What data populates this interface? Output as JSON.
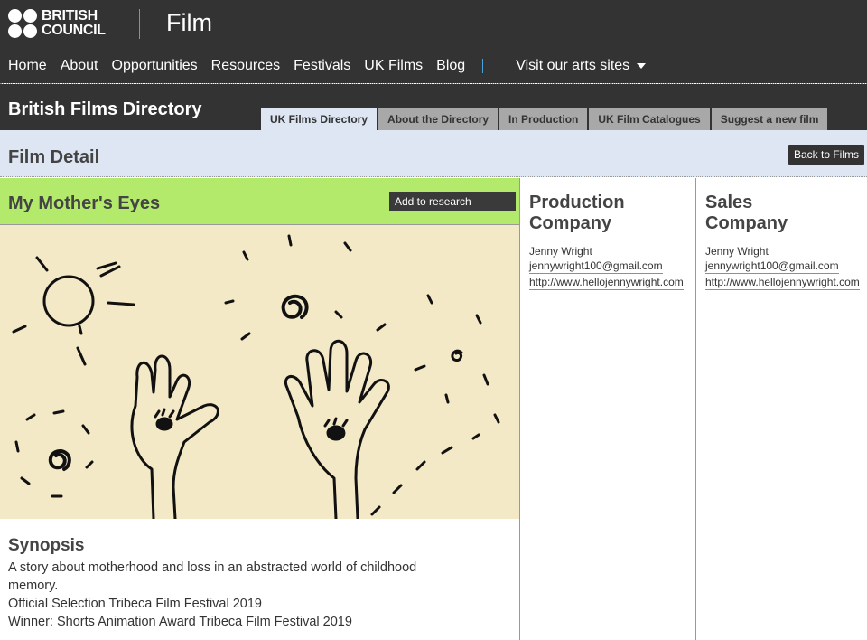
{
  "header": {
    "logo_line1": "BRITISH",
    "logo_line2": "COUNCIL",
    "site_name": "Film"
  },
  "nav": {
    "items": [
      "Home",
      "About",
      "Opportunities",
      "Resources",
      "Festivals",
      "UK Films",
      "Blog"
    ],
    "arts_label": "Visit our arts sites"
  },
  "directory": {
    "title": "British Films Directory",
    "tabs": [
      "UK Films Directory",
      "About the Directory",
      "In Production",
      "UK Film Catalogues",
      "Suggest a new film"
    ],
    "active_tab": "UK Films Directory"
  },
  "detail": {
    "title": "Film Detail",
    "back_label": "Back to Films"
  },
  "film": {
    "title": "My Mother's Eyes",
    "research_label": "Add to research",
    "synopsis_heading": "Synopsis",
    "synopsis_lines": [
      "A story about motherhood and loss in an abstracted world of childhood",
      "memory.",
      "Official Selection Tribeca Film Festival 2019",
      "Winner: Shorts Animation Award Tribeca Film Festival 2019"
    ]
  },
  "production": {
    "heading_line1": "Production",
    "heading_line2": "Company",
    "name": "Jenny Wright",
    "email": "jennywright100@gmail.com",
    "url": "http://www.hellojennywright.com"
  },
  "sales": {
    "heading_line1": "Sales",
    "heading_line2": "Company",
    "name": "Jenny Wright",
    "email": "jennywright100@gmail.com",
    "url": "http://www.hellojennywright.com"
  },
  "colors": {
    "header_bg": "#333333",
    "accent_blue": "#4aa3df",
    "detail_bar": "#dde6f2",
    "film_header": "#b3ea6c",
    "still_bg": "#f3e9c6"
  }
}
